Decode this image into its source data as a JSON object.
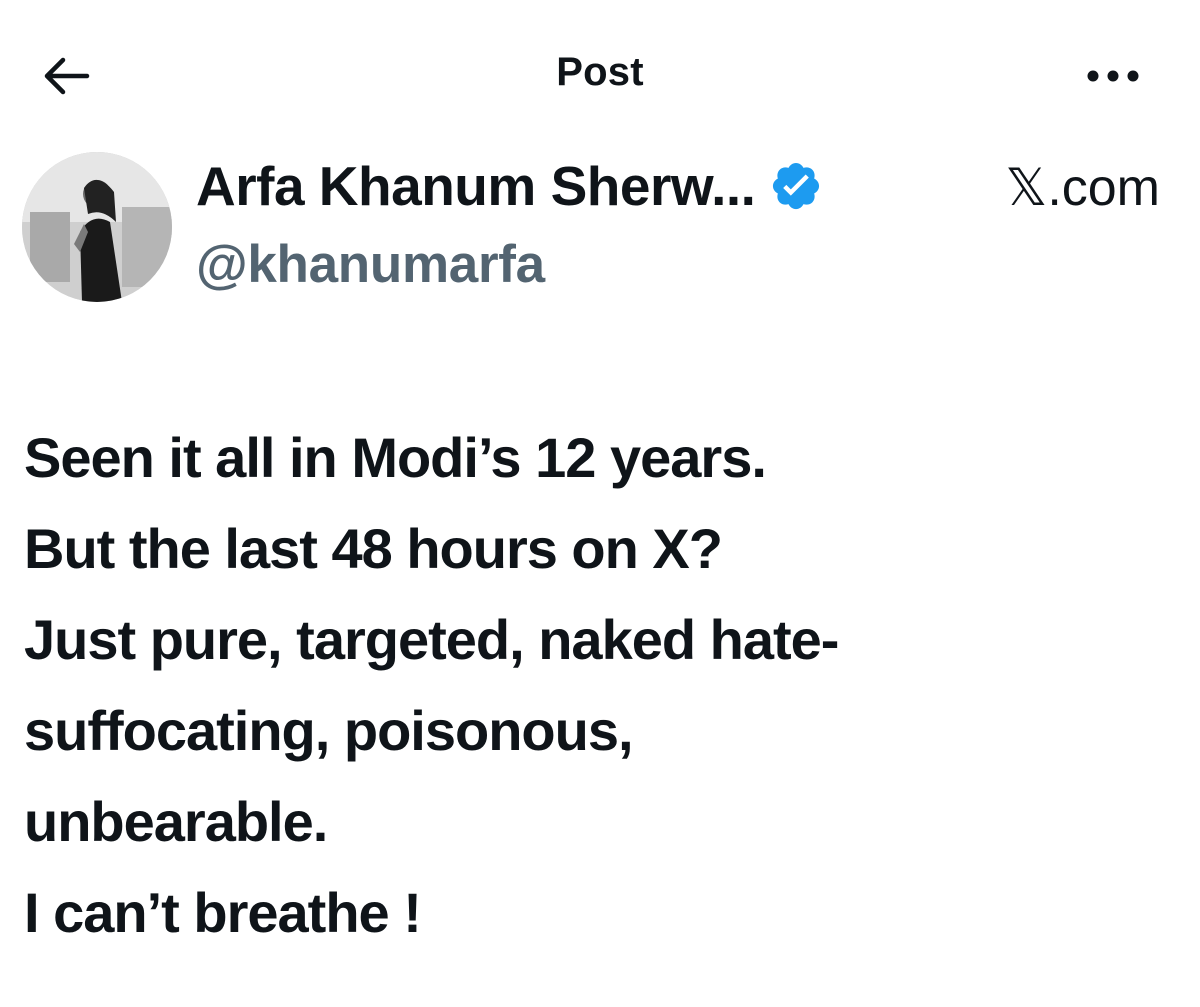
{
  "header": {
    "title": "Post",
    "back_icon": "arrow-left-icon",
    "more_icon": "more-horizontal-icon"
  },
  "author": {
    "display_name": "Arfa Khanum Sherw...",
    "handle": "@khanumarfa",
    "verified_icon": "verified-badge-icon",
    "verified_color": "#1d9bf0",
    "avatar": "profile-photo"
  },
  "brand": {
    "label": "𝕏.com"
  },
  "post": {
    "lines": [
      "Seen it all in Modi’s 12 years.",
      "But the last 48 hours on X?",
      "Just pure, targeted, naked hate-",
      "suffocating, poisonous,",
      "unbearable.",
      "I can’t breathe !"
    ]
  },
  "colors": {
    "text": "#0f1419",
    "secondary": "#536471",
    "accent": "#1d9bf0",
    "background": "#ffffff"
  }
}
